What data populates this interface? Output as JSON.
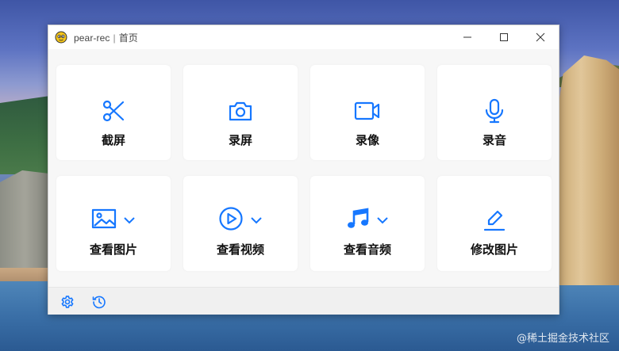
{
  "window": {
    "app_name": "pear-rec",
    "separator": "|",
    "page_name": "首页"
  },
  "colors": {
    "accent": "#1677ff"
  },
  "cards": [
    {
      "label": "截屏",
      "icon": "scissors-icon"
    },
    {
      "label": "录屏",
      "icon": "camera-icon"
    },
    {
      "label": "录像",
      "icon": "video-camera-icon"
    },
    {
      "label": "录音",
      "icon": "microphone-icon"
    },
    {
      "label": "查看图片",
      "icon": "image-icon",
      "dropdown": true
    },
    {
      "label": "查看视频",
      "icon": "play-circle-icon",
      "dropdown": true
    },
    {
      "label": "查看音频",
      "icon": "music-note-icon",
      "dropdown": true
    },
    {
      "label": "修改图片",
      "icon": "edit-pen-icon"
    }
  ],
  "footer": {
    "icons": [
      "settings-gear-icon",
      "history-clock-icon"
    ]
  },
  "watermark": "@稀土掘金技术社区"
}
